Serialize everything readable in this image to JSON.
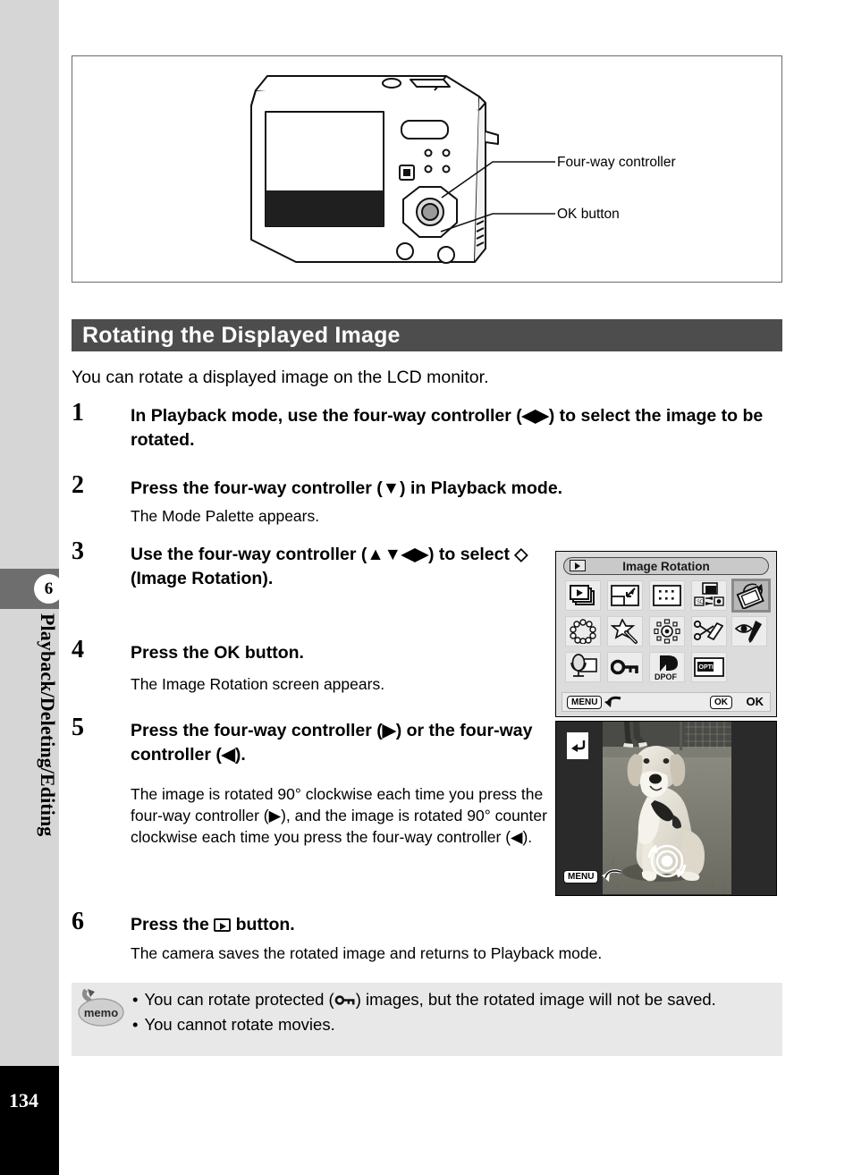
{
  "page": {
    "number": "134",
    "chapter_number": "6",
    "chapter_title": "Playback/Deleting/Editing"
  },
  "illustration": {
    "callouts": [
      {
        "label": "Four-way controller"
      },
      {
        "label": "OK button"
      }
    ],
    "camera_icon": "camera-rear-view-illustration"
  },
  "section": {
    "heading": "Rotating the Displayed Image",
    "intro": "You can rotate a displayed image on the LCD monitor."
  },
  "steps": [
    {
      "number": "1",
      "title": "In Playback mode, use the four-way controller (◀▶) to select the image to be rotated.",
      "description": ""
    },
    {
      "number": "2",
      "title": "Press the four-way controller (▼) in Playback mode.",
      "description": "The Mode Palette appears."
    },
    {
      "number": "3",
      "title": "Use the four-way controller (▲▼◀▶) to select ◇ (Image Rotation).",
      "description": ""
    },
    {
      "number": "4",
      "title": "Press the OK button.",
      "description": "The Image Rotation screen appears."
    },
    {
      "number": "5",
      "title": "Press the four-way controller (▶) or the four-way controller (◀).",
      "description": "The image is rotated 90° clockwise each time you press the four-way controller (▶), and the image is rotated 90° counter clockwise each time you press the four-way controller (◀)."
    },
    {
      "number": "6",
      "title_before": "Press the ",
      "title_after": " button.",
      "description": "The camera saves the rotated image and returns to Playback mode."
    }
  ],
  "lcd_mode_palette": {
    "title": "Image Rotation",
    "title_icon": "playback-icon",
    "icons": [
      {
        "name": "slideshow-icon",
        "selected": false
      },
      {
        "name": "resize-icon",
        "selected": false
      },
      {
        "name": "frame-composite-icon",
        "selected": false
      },
      {
        "name": "image-copy-icon",
        "selected": false
      },
      {
        "name": "image-rotation-icon",
        "selected": true
      },
      {
        "name": "frame-decoration-icon",
        "selected": false
      },
      {
        "name": "digital-filter-icon",
        "selected": false
      },
      {
        "name": "brightness-filter-icon",
        "selected": false
      },
      {
        "name": "trimming-icon",
        "selected": false
      },
      {
        "name": "red-eye-compensation-icon",
        "selected": false
      },
      {
        "name": "voice-memo-icon",
        "selected": false
      },
      {
        "name": "protect-icon",
        "selected": false
      },
      {
        "name": "dpof-icon",
        "selected": false
      },
      {
        "name": "start-up-screen-icon",
        "selected": false
      }
    ],
    "footer": {
      "menu_key": "MENU",
      "menu_action": "back-arrow-icon",
      "ok_key": "OK",
      "ok_label": "OK"
    }
  },
  "lcd_image_rotation": {
    "enter_badge": "enter-arrow-icon",
    "menu_key": "MENU",
    "menu_action": "back-arrow-icon",
    "rotation_indicator": "rotation-dial-icon",
    "photo": "golden-retriever-dog-on-grass"
  },
  "memo": {
    "icon_label": "memo",
    "items": [
      {
        "bullet": "•",
        "text_before": "You can rotate protected (",
        "symbol": "protect-key-icon",
        "text_after": ") images, but the rotated image will not be saved."
      },
      {
        "bullet": "•",
        "text_before": "You cannot rotate movies.",
        "symbol": "",
        "text_after": ""
      }
    ]
  },
  "colors": {
    "heading_bar": "#4d4d4d",
    "rail": "#d6d6d6",
    "rail_tab": "#6e6e6e",
    "memo_bg": "#e8e8e8",
    "page_block": "#000000"
  }
}
